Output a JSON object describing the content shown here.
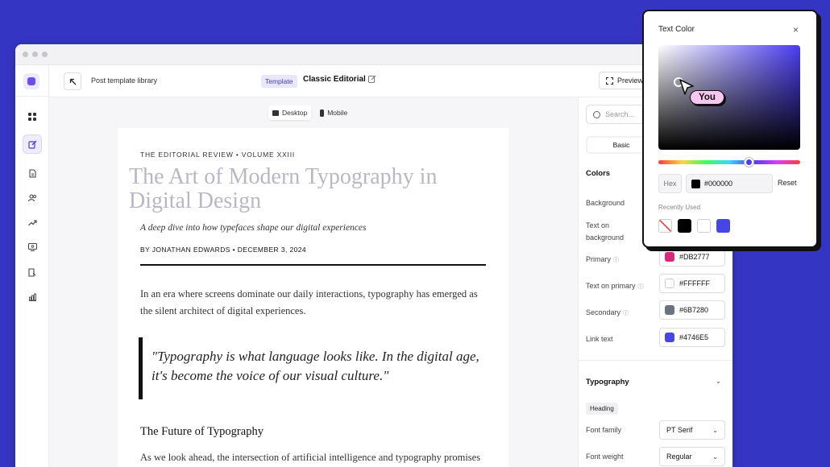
{
  "topbar": {
    "back_label": "Post template library",
    "template_badge": "Template",
    "template_name": "Classic Editorial",
    "preview_label": "Preview"
  },
  "canvas": {
    "devices": [
      "Desktop",
      "Mobile"
    ],
    "active_device": "Desktop"
  },
  "article": {
    "kicker": "THE EDITORIAL REVIEW • VOLUME XXIII",
    "headline": "The Art of Modern Typography in Digital Design",
    "dek": "A deep dive into how typefaces shape our digital experiences",
    "byline": "BY JONATHAN EDWARDS • DECEMBER 3, 2024",
    "para1": "In an era where screens dominate our daily interactions, typography has emerged as the silent architect of digital experiences.",
    "quote": "\"Typography is what language looks like. In the digital age, it's become the voice of our visual culture.\"",
    "subhead": "The Future of Typography",
    "para2": "As we look ahead, the intersection of artificial intelligence and typography promises new frontiers. Dynamic fonts that adapt to individual readers"
  },
  "panel": {
    "search_placeholder": "Search...",
    "tab_basic": "Basic",
    "colors_title": "Colors",
    "colors": [
      {
        "label": "Background",
        "hex": "",
        "info": false
      },
      {
        "label": "Text on background",
        "hex": "",
        "info": false
      },
      {
        "label": "Primary",
        "hex": "#DB2777",
        "info": true
      },
      {
        "label": "Text on primary",
        "hex": "#FFFFFF",
        "info": true
      },
      {
        "label": "Secondary",
        "hex": "#6B7280",
        "info": true
      },
      {
        "label": "Link text",
        "hex": "#4746E5",
        "info": false
      }
    ],
    "typography_title": "Typography",
    "heading_badge": "Heading",
    "font_family_label": "Font family",
    "font_family_value": "PT Serif",
    "font_weight_label": "Font weight",
    "font_weight_value": "Regular"
  },
  "popover": {
    "title": "Text Color",
    "cursor_tag": "You",
    "hex_label": "Hex",
    "hex_value": "#000000",
    "reset_label": "Reset",
    "recent_label": "Recently Used",
    "recent_colors": [
      "none",
      "#000000",
      "#FFFFFF",
      "#4746E5"
    ]
  }
}
